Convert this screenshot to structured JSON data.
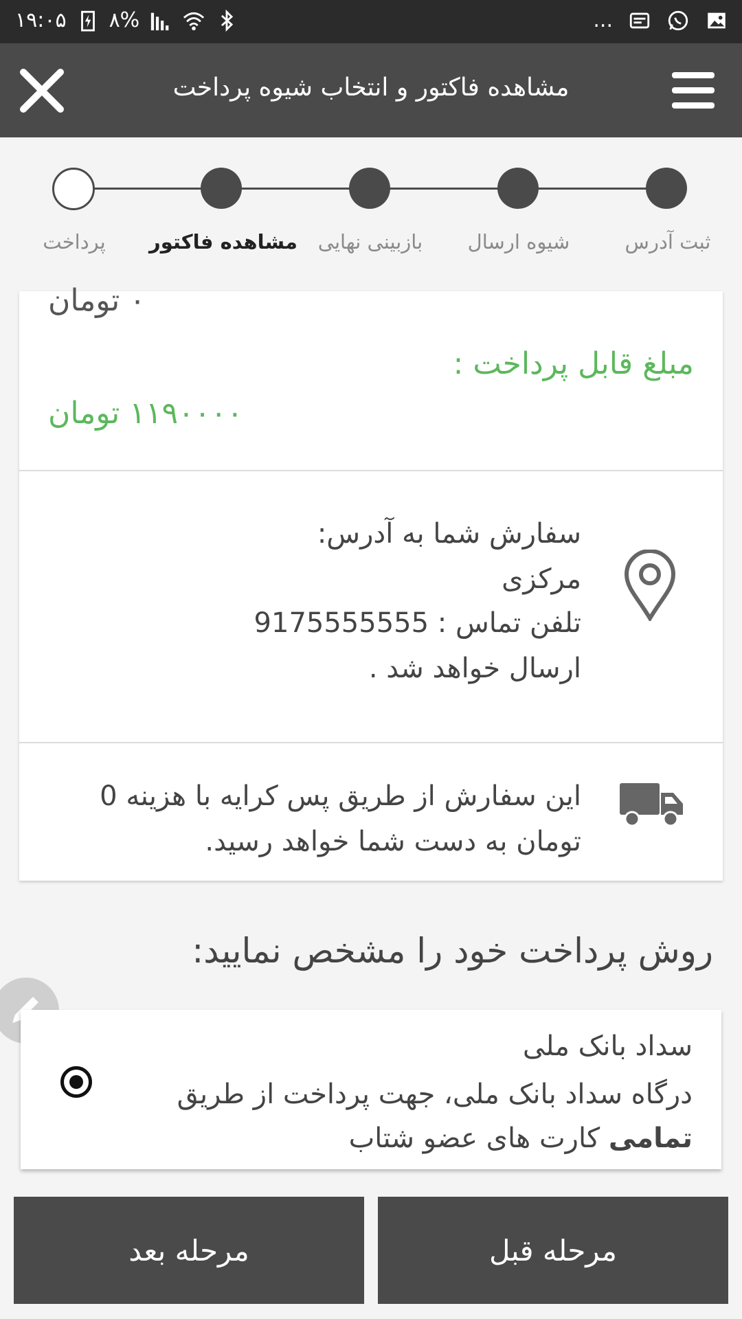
{
  "status_bar": {
    "time": "۱۹:۰۵",
    "battery": "۸%",
    "more": "..."
  },
  "app_bar": {
    "title": "مشاهده فاکتور و انتخاب شیوه پرداخت"
  },
  "stepper": {
    "steps": [
      {
        "label": "ثبت آدرس",
        "state": "done"
      },
      {
        "label": "شیوه ارسال",
        "state": "done"
      },
      {
        "label": "بازبینی نهایی",
        "state": "done"
      },
      {
        "label": "مشاهده فاکتور",
        "state": "current"
      },
      {
        "label": "پرداخت",
        "state": "pending"
      }
    ]
  },
  "invoice": {
    "discount_value": "۰ تومان",
    "payable_label": "مبلغ قابل پرداخت :",
    "payable_value": "۱۱۹۰۰۰۰ تومان",
    "address_line1": "سفارش شما به آدرس:",
    "address_line2": "مرکزی",
    "address_line3": "تلفن تماس : 9175555555",
    "address_line4": "ارسال خواهد شد .",
    "shipping_line1": "این سفارش از طریق پس کرایه با هزینه 0",
    "shipping_line2": "تومان به دست شما خواهد رسید."
  },
  "payment": {
    "section_title": "روش پرداخت خود را مشخص نمایید:",
    "option_title": "سداد بانک ملی",
    "option_desc_line1": "درگاه سداد بانک ملی، جهت پرداخت از طریق",
    "option_desc_bold": "تمامی",
    "option_desc_line2_rest": " کارت های عضو شتاب"
  },
  "buttons": {
    "prev": "مرحله قبل",
    "next": "مرحله بعد"
  },
  "colors": {
    "green": "#5cb85c",
    "dark": "#4a4a4a",
    "status_bar": "#2b2b2b"
  }
}
